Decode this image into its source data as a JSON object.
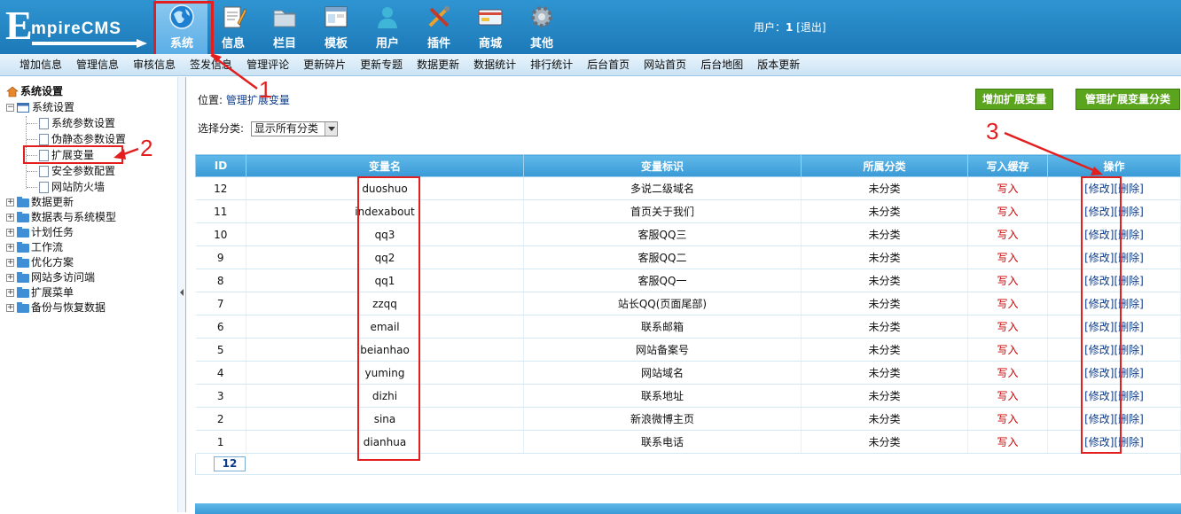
{
  "header": {
    "logo_initial": "E",
    "logo_rest": "mpireCMS",
    "nav": [
      {
        "label": "系统",
        "icon": "globe-icon",
        "active": true
      },
      {
        "label": "信息",
        "icon": "notepad-icon",
        "active": false
      },
      {
        "label": "栏目",
        "icon": "folder-icon",
        "active": false
      },
      {
        "label": "模板",
        "icon": "window-icon",
        "active": false
      },
      {
        "label": "用户",
        "icon": "user-icon",
        "active": false
      },
      {
        "label": "插件",
        "icon": "tools-icon",
        "active": false
      },
      {
        "label": "商城",
        "icon": "card-icon",
        "active": false
      },
      {
        "label": "其他",
        "icon": "gear-icon",
        "active": false
      }
    ],
    "user_label": "用户：",
    "user_name": "1",
    "logout": "[退出]"
  },
  "subnav": [
    "增加信息",
    "管理信息",
    "审核信息",
    "签发信息",
    "管理评论",
    "更新碎片",
    "更新专题",
    "数据更新",
    "数据统计",
    "排行统计",
    "后台首页",
    "网站首页",
    "后台地图",
    "版本更新"
  ],
  "sidebar": {
    "root": "系统设置",
    "group": "系统设置",
    "children": [
      "系统参数设置",
      "伪静态参数设置",
      "扩展变量",
      "安全参数配置",
      "网站防火墙"
    ],
    "folders": [
      "数据更新",
      "数据表与系统模型",
      "计划任务",
      "工作流",
      "优化方案",
      "网站多访问端",
      "扩展菜单",
      "备份与恢复数据"
    ]
  },
  "content": {
    "location_label": "位置: ",
    "location_link": "管理扩展变量",
    "add_button": "增加扩展变量",
    "manage_class_button": "管理扩展变量分类",
    "select_label": "选择分类:",
    "select_value": "显示所有分类",
    "table": {
      "headers": [
        "ID",
        "变量名",
        "变量标识",
        "所属分类",
        "写入缓存",
        "操作"
      ],
      "rows": [
        {
          "id": "12",
          "name": "duoshuo",
          "label": "多说二级域名",
          "cat": "未分类",
          "cache": "写入",
          "edit": "[修改]",
          "del": "[删除]"
        },
        {
          "id": "11",
          "name": "indexabout",
          "label": "首页关于我们",
          "cat": "未分类",
          "cache": "写入",
          "edit": "[修改]",
          "del": "[删除]"
        },
        {
          "id": "10",
          "name": "qq3",
          "label": "客服QQ三",
          "cat": "未分类",
          "cache": "写入",
          "edit": "[修改]",
          "del": "[删除]"
        },
        {
          "id": "9",
          "name": "qq2",
          "label": "客服QQ二",
          "cat": "未分类",
          "cache": "写入",
          "edit": "[修改]",
          "del": "[删除]"
        },
        {
          "id": "8",
          "name": "qq1",
          "label": "客服QQ一",
          "cat": "未分类",
          "cache": "写入",
          "edit": "[修改]",
          "del": "[删除]"
        },
        {
          "id": "7",
          "name": "zzqq",
          "label": "站长QQ(页面尾部)",
          "cat": "未分类",
          "cache": "写入",
          "edit": "[修改]",
          "del": "[删除]"
        },
        {
          "id": "6",
          "name": "email",
          "label": "联系邮箱",
          "cat": "未分类",
          "cache": "写入",
          "edit": "[修改]",
          "del": "[删除]"
        },
        {
          "id": "5",
          "name": "beianhao",
          "label": "网站备案号",
          "cat": "未分类",
          "cache": "写入",
          "edit": "[修改]",
          "del": "[删除]"
        },
        {
          "id": "4",
          "name": "yuming",
          "label": "网站域名",
          "cat": "未分类",
          "cache": "写入",
          "edit": "[修改]",
          "del": "[删除]"
        },
        {
          "id": "3",
          "name": "dizhi",
          "label": "联系地址",
          "cat": "未分类",
          "cache": "写入",
          "edit": "[修改]",
          "del": "[删除]"
        },
        {
          "id": "2",
          "name": "sina",
          "label": "新浪微博主页",
          "cat": "未分类",
          "cache": "写入",
          "edit": "[修改]",
          "del": "[删除]"
        },
        {
          "id": "1",
          "name": "dianhua",
          "label": "联系电话",
          "cat": "未分类",
          "cache": "写入",
          "edit": "[修改]",
          "del": "[删除]"
        }
      ]
    },
    "page": "12"
  },
  "annotations": {
    "one": "1",
    "two": "2",
    "three": "3",
    "color": "#e21e1e"
  }
}
